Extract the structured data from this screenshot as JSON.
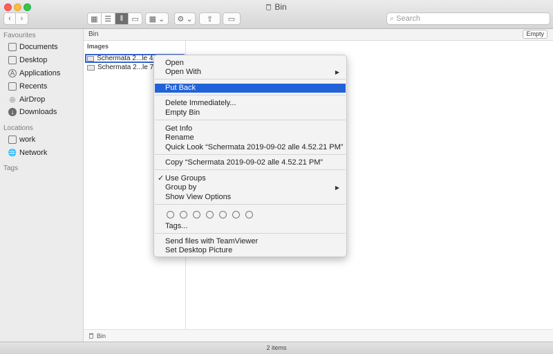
{
  "window": {
    "title": "Bin"
  },
  "toolbar": {
    "back_icon": "chevron-left",
    "forward_icon": "chevron-right",
    "search_placeholder": "Search"
  },
  "sidebar": {
    "favourites_header": "Favourites",
    "favourites": [
      "Documents",
      "Desktop",
      "Applications",
      "Recents",
      "AirDrop",
      "Downloads"
    ],
    "locations_header": "Locations",
    "locations": [
      "work",
      "Network"
    ],
    "tags_header": "Tags"
  },
  "pathbar": {
    "title": "Bin",
    "empty_label": "Empty"
  },
  "column": {
    "header": "Images",
    "files": [
      "Schermata 2...le 4.52.21 PM",
      "Schermata 2...le 7.3"
    ]
  },
  "bottom_path": "Bin",
  "status": "2 items",
  "context_menu": {
    "open": "Open",
    "open_with": "Open With",
    "put_back": "Put Back",
    "delete_immediately": "Delete Immediately...",
    "empty_bin": "Empty Bin",
    "get_info": "Get Info",
    "rename": "Rename",
    "quick_look": "Quick Look “Schermata 2019-09-02 alle 4.52.21 PM”",
    "copy": "Copy “Schermata 2019-09-02 alle 4.52.21 PM”",
    "use_groups": "Use Groups",
    "group_by": "Group by",
    "show_view_options": "Show View Options",
    "tags": "Tags...",
    "teamviewer": "Send files with TeamViewer",
    "set_desktop": "Set Desktop Picture"
  },
  "colors": {
    "selection": "#2162d9",
    "close": "#fc605c",
    "minimize": "#fdbc40",
    "maximize": "#34c84a"
  }
}
